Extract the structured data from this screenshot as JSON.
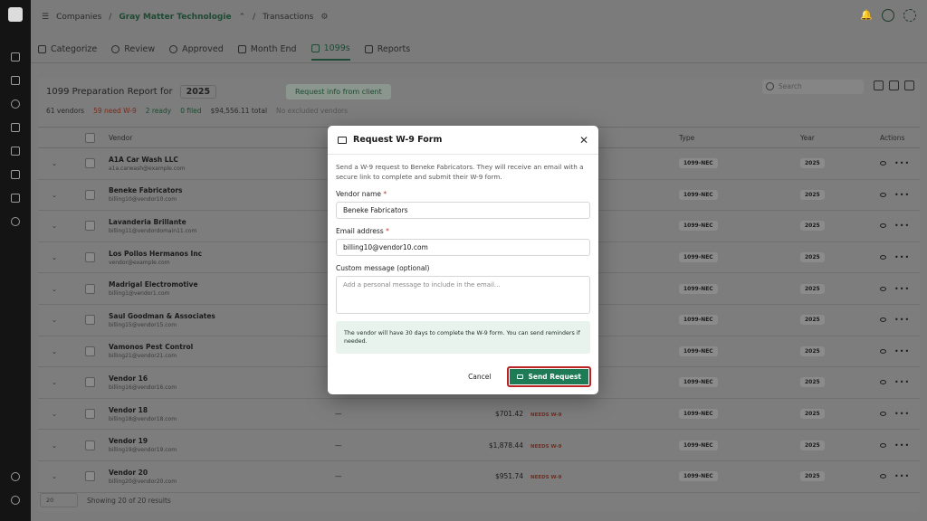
{
  "topbar": {
    "crumb_companies": "Companies",
    "crumb_company": "Gray Matter Technologie",
    "crumb_page": "Transactions"
  },
  "tabs": [
    {
      "label": "Categorize"
    },
    {
      "label": "Review"
    },
    {
      "label": "Approved"
    },
    {
      "label": "Month End"
    },
    {
      "label": "1099s"
    },
    {
      "label": "Reports"
    }
  ],
  "report": {
    "title": "1099 Preparation Report for",
    "year": "2025",
    "request_button": "Request info from client",
    "search_placeholder": "Search",
    "stats": {
      "vendors": "61 vendors",
      "need_w9": "59 need W-9",
      "ready": "2 ready",
      "filed": "0 filed",
      "total": "$94,556.11 total",
      "excluded": "No excluded vendors"
    },
    "columns": {
      "vendor": "Vendor",
      "type": "Type",
      "year": "Year",
      "actions": "Actions"
    },
    "rows": [
      {
        "name": "A1A Car Wash LLC",
        "email": "a1a.carwash@example.com",
        "tin": "",
        "amount": "",
        "status": "",
        "type": "1099-NEC",
        "year": "2025"
      },
      {
        "name": "Beneke Fabricators",
        "email": "billing10@vendor10.com",
        "tin": "",
        "amount": "",
        "status": "",
        "type": "1099-NEC",
        "year": "2025"
      },
      {
        "name": "Lavanderia Brillante",
        "email": "billing11@vendordomain11.com",
        "tin": "",
        "amount": "",
        "status": "",
        "type": "1099-NEC",
        "year": "2025"
      },
      {
        "name": "Los Pollos Hermanos Inc",
        "email": "vendor@example.com",
        "tin": "",
        "amount": "",
        "status": "",
        "type": "1099-NEC",
        "year": "2025"
      },
      {
        "name": "Madrigal Electromotive",
        "email": "billing1@vendor1.com",
        "tin": "",
        "amount": "",
        "status": "",
        "type": "1099-NEC",
        "year": "2025"
      },
      {
        "name": "Saul Goodman & Associates",
        "email": "billing15@vendor15.com",
        "tin": "",
        "amount": "",
        "status": "",
        "type": "1099-NEC",
        "year": "2025"
      },
      {
        "name": "Vamonos Pest Control",
        "email": "billing21@vendor21.com",
        "tin": "",
        "amount": "",
        "status": "",
        "type": "1099-NEC",
        "year": "2025"
      },
      {
        "name": "Vendor 16",
        "email": "billing16@vendor16.com",
        "tin": "",
        "amount": "",
        "status": "",
        "type": "1099-NEC",
        "year": "2025"
      },
      {
        "name": "Vendor 18",
        "email": "billing18@vendor18.com",
        "tin": "—",
        "amount": "$701.42",
        "status": "NEEDS W-9",
        "type": "1099-NEC",
        "year": "2025"
      },
      {
        "name": "Vendor 19",
        "email": "billing19@vendor19.com",
        "tin": "—",
        "amount": "$1,878.44",
        "status": "NEEDS W-9",
        "type": "1099-NEC",
        "year": "2025"
      },
      {
        "name": "Vendor 20",
        "email": "billing20@vendor20.com",
        "tin": "—",
        "amount": "$951.74",
        "status": "NEEDS W-9",
        "type": "1099-NEC",
        "year": "2025"
      }
    ],
    "footer": {
      "page_size": "20",
      "summary": "Showing 20 of 20 results"
    }
  },
  "modal": {
    "title": "Request W-9 Form",
    "description": "Send a W-9 request to Beneke Fabricators. They will receive an email with a secure link to complete and submit their W-9 form.",
    "vendor_name_label": "Vendor name",
    "vendor_name_value": "Beneke Fabricators",
    "email_label": "Email address",
    "email_value": "billing10@vendor10.com",
    "message_label": "Custom message (optional)",
    "message_placeholder": "Add a personal message to include in the email...",
    "note": "The vendor will have 30 days to complete the W-9 form. You can send reminders if needed.",
    "required_mark": "*",
    "cancel_label": "Cancel",
    "send_label": "Send Request"
  }
}
